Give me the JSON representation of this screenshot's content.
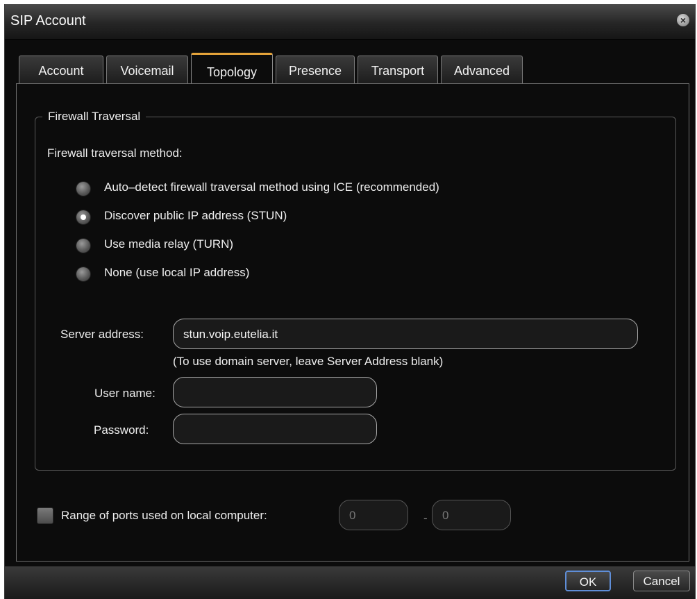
{
  "window": {
    "title": "SIP Account"
  },
  "tabs": [
    {
      "label": "Account"
    },
    {
      "label": "Voicemail"
    },
    {
      "label": "Topology",
      "active": true
    },
    {
      "label": "Presence"
    },
    {
      "label": "Transport"
    },
    {
      "label": "Advanced"
    }
  ],
  "firewall": {
    "legend": "Firewall Traversal",
    "method_label": "Firewall traversal method:",
    "options": [
      {
        "label": "Auto–detect firewall traversal method using ICE (recommended)",
        "selected": false
      },
      {
        "label": "Discover public IP address (STUN)",
        "selected": true
      },
      {
        "label": "Use media relay (TURN)",
        "selected": false
      },
      {
        "label": "None (use local IP address)",
        "selected": false
      }
    ],
    "server_label": "Server address:",
    "server_value": "stun.voip.eutelia.it",
    "server_hint": "(To use domain server, leave Server Address blank)",
    "username_label": "User name:",
    "username_value": "",
    "password_label": "Password:",
    "password_value": ""
  },
  "ports": {
    "label": "Range of ports used on local computer:",
    "checked": false,
    "from": "0",
    "separator": "-",
    "to": "0"
  },
  "footer": {
    "ok_label": "OK",
    "cancel_label": "Cancel"
  },
  "icons": {
    "close": "close-icon"
  },
  "colors": {
    "accent_tab": "#e6a43a",
    "ok_border": "#5f8ed8"
  }
}
